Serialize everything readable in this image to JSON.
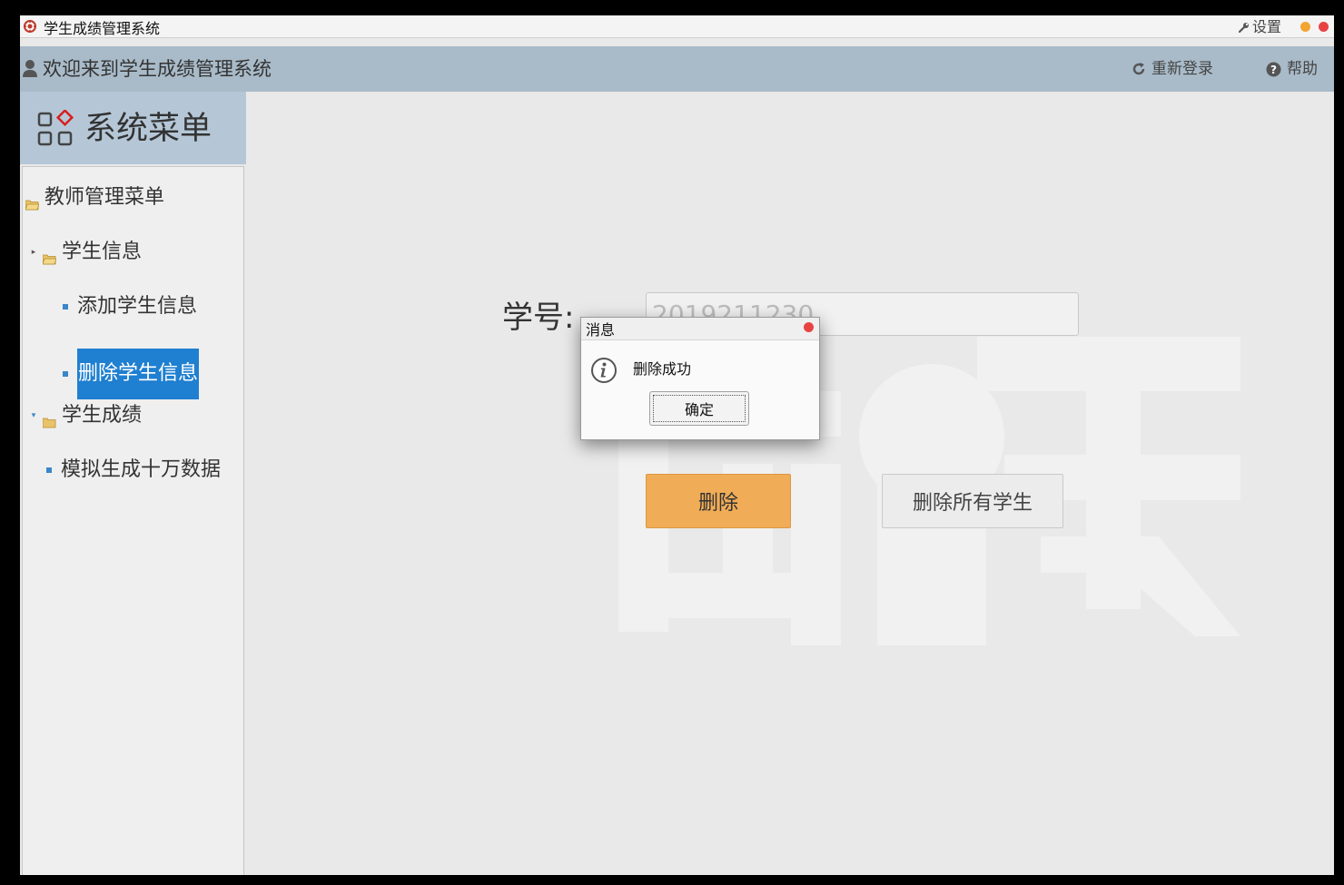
{
  "window": {
    "title": "学生成绩管理系统",
    "settings_label": "设置"
  },
  "header": {
    "welcome": "欢迎来到学生成绩管理系统",
    "relogin_label": "重新登录",
    "help_label": "帮助"
  },
  "menu": {
    "title": "系统菜单",
    "items": [
      {
        "label": "教师管理菜单"
      },
      {
        "label": "学生信息"
      },
      {
        "label": "添加学生信息"
      },
      {
        "label": "删除学生信息"
      },
      {
        "label": "学生成绩"
      },
      {
        "label": "模拟生成十万数据"
      }
    ]
  },
  "form": {
    "student_id_label": "学号:",
    "student_id_value": "2019211230",
    "delete_label": "删除",
    "delete_all_label": "删除所有学生"
  },
  "dialog": {
    "title": "消息",
    "message": "删除成功",
    "ok_label": "确定"
  },
  "colors": {
    "header_bg": "#a9bbc9",
    "menu_head_bg": "#b5c7d7",
    "selected_item": "#1f7fd0",
    "delete_button": "#f1ac57",
    "close_dot": "#e84343",
    "minimize_dot": "#f2a531"
  }
}
